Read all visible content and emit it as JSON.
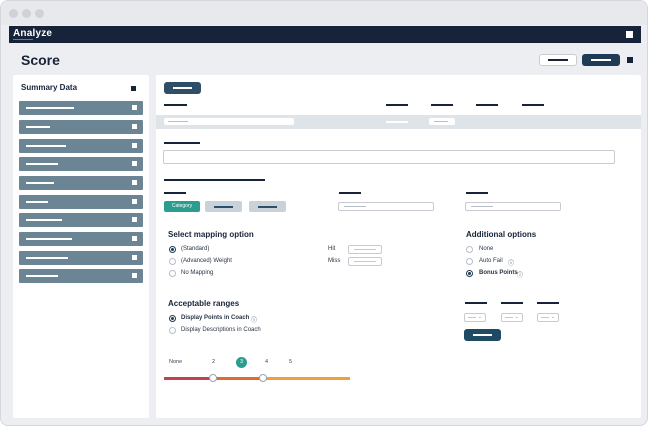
{
  "app": {
    "brand": "Analyze"
  },
  "header": {
    "title": "Score"
  },
  "sidebar": {
    "title": "Summary Data",
    "item_count": 10
  },
  "filters": {
    "chip_label": "Category"
  },
  "mapping": {
    "title": "Select mapping option",
    "options": [
      {
        "label": "(Standard)",
        "selected": true
      },
      {
        "label": "(Advanced) Weight",
        "selected": false
      },
      {
        "label": "No Mapping",
        "selected": false
      }
    ],
    "hit_label": "Hit",
    "miss_label": "Miss"
  },
  "additional": {
    "title": "Additional options",
    "options": [
      {
        "label": "None",
        "selected": false
      },
      {
        "label": "Auto Fail",
        "selected": false,
        "icon": "info-icon"
      },
      {
        "label": "Bonus Points",
        "selected": true,
        "icon": "info-icon"
      }
    ]
  },
  "ranges": {
    "title": "Acceptable ranges",
    "options": [
      {
        "label": "Display Points in Coach",
        "selected": true,
        "icon": "info-icon"
      },
      {
        "label": "Display Descriptions in Coach",
        "selected": false
      }
    ]
  },
  "scale": {
    "labels": [
      "None",
      "2",
      "3",
      "4",
      "5"
    ],
    "selected": "3",
    "colors": {
      "low": "#c0444f",
      "mid": "#e26a2c",
      "high": "#f0a03a"
    }
  }
}
